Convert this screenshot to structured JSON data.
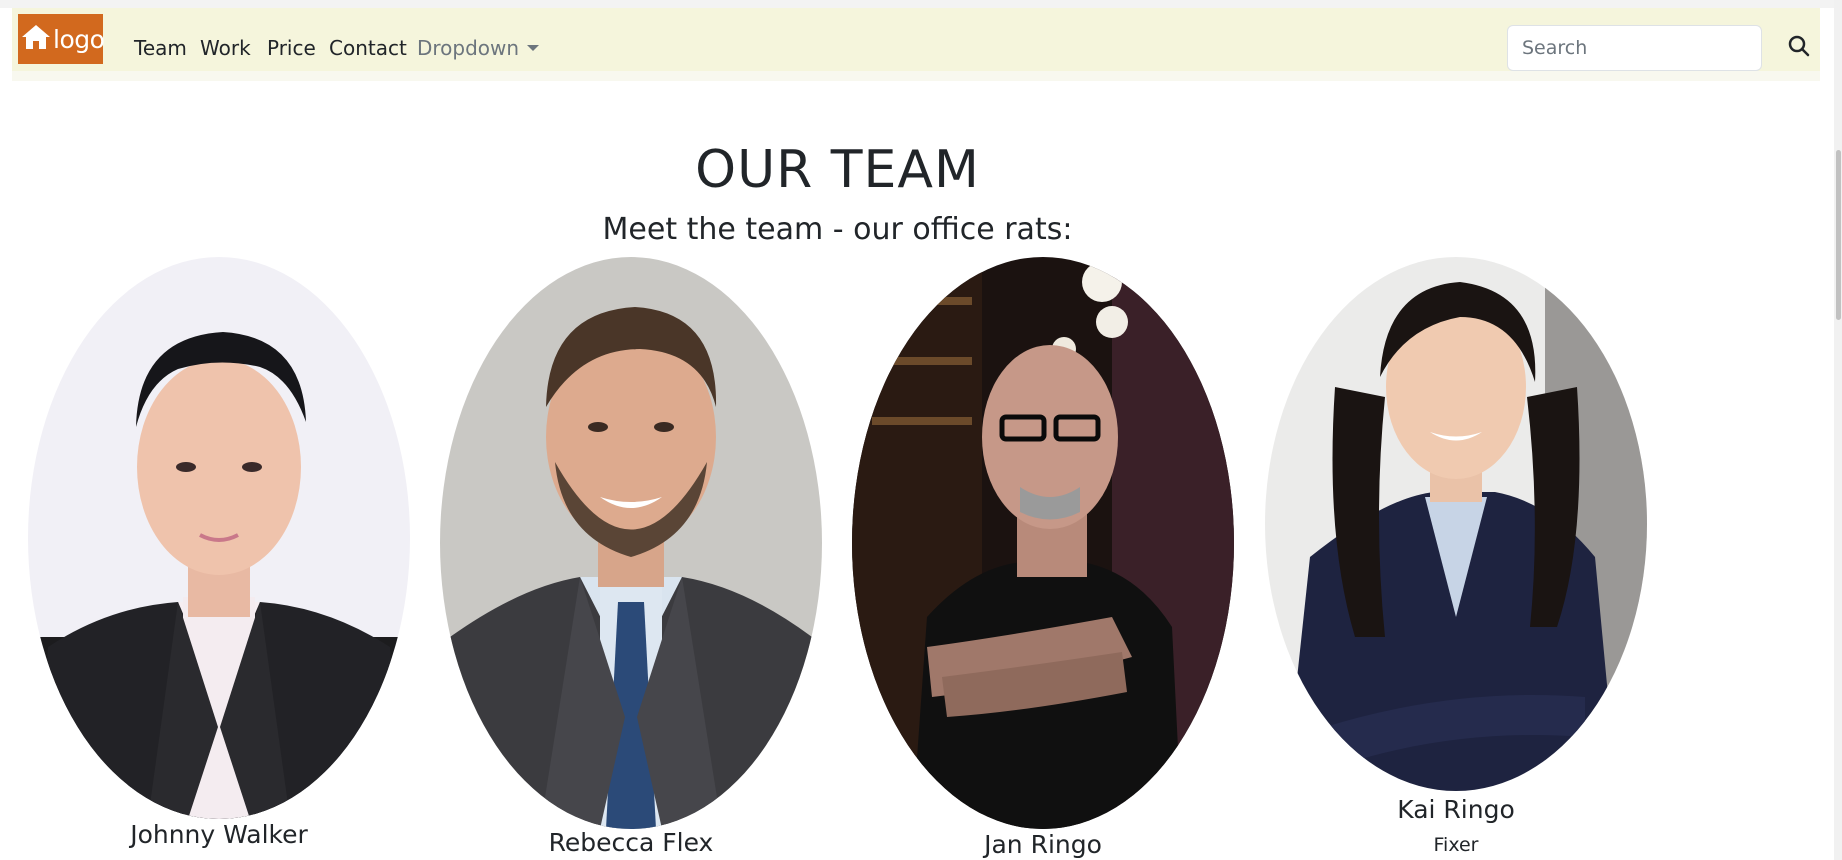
{
  "navbar": {
    "brand_text": "logo",
    "brand_color": "#d2691e",
    "background": "#f5f5dc",
    "links": [
      "Team",
      "Work",
      "Price",
      "Contact"
    ],
    "dropdown_label": "Dropdown",
    "search": {
      "placeholder": "Search",
      "value": ""
    },
    "icons": {
      "brand": "home-icon",
      "search": "search-icon",
      "dropdown": "caret-down-icon"
    }
  },
  "main": {
    "title": "OUR TEAM",
    "subtitle": "Meet the team - our office rats:",
    "members": [
      {
        "name": "Johnny Walker",
        "role": ""
      },
      {
        "name": "Rebecca Flex",
        "role": ""
      },
      {
        "name": "Jan Ringo",
        "role": ""
      },
      {
        "name": "Kai Ringo",
        "role": "Fixer"
      }
    ]
  }
}
